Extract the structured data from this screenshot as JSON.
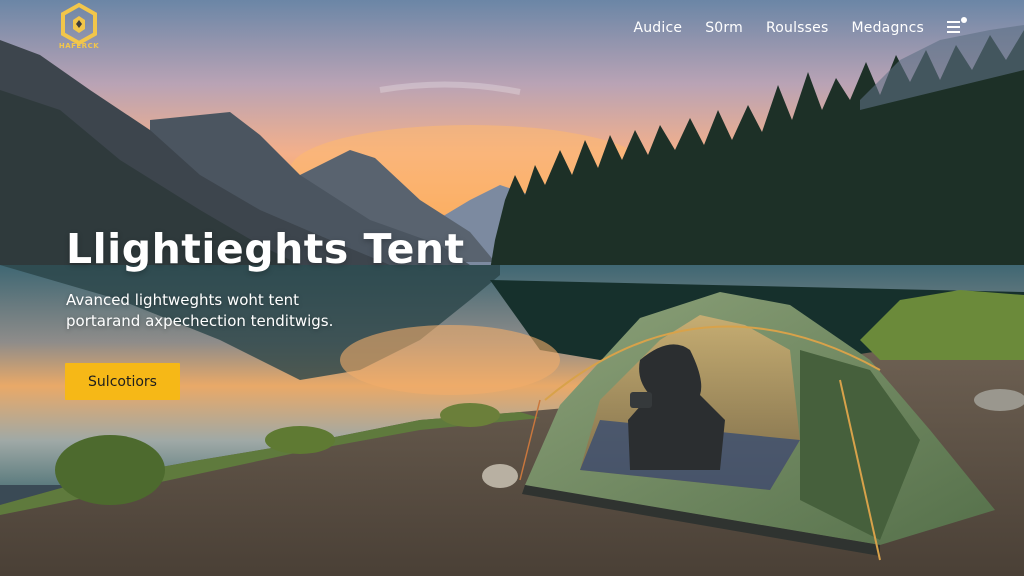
{
  "brand": {
    "logo_text": "HAFERCK"
  },
  "nav": {
    "items": [
      "Audice",
      "S0rm",
      "Roulsses",
      "Medagncs"
    ]
  },
  "hero": {
    "title": "Llightieghts Tent",
    "subtitle_line1": "Avanced lightweghts woht tent",
    "subtitle_line2": "portarand axpechection tenditwigs.",
    "cta_label": "Sulcotiors"
  },
  "colors": {
    "accent": "#f6b817",
    "logo": "#f2c64a",
    "nav_text": "#ffffff"
  },
  "icons": {
    "menu": "hamburger-icon",
    "logo": "hexagon-logo-icon"
  }
}
